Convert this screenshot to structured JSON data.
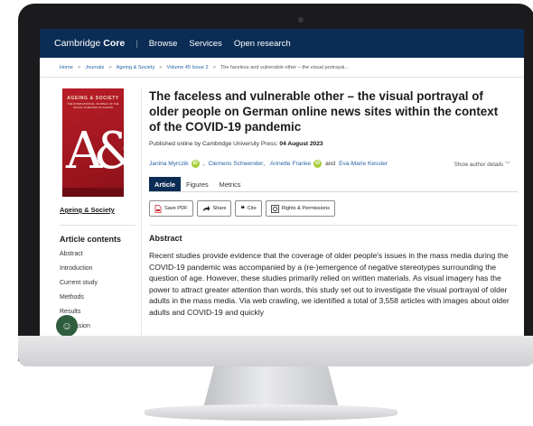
{
  "nav": {
    "logo_regular": "Cambridge",
    "logo_bold": "Core",
    "links": [
      "Browse",
      "Services",
      "Open research"
    ]
  },
  "breadcrumb": [
    "Home",
    "Journals",
    "Ageing & Society",
    "Volume 45 Issue 2",
    "The faceless and vulnerable other – the visual portrayal..."
  ],
  "journal": {
    "cover_title": "AGEING & SOCIETY",
    "cover_subtitle": "THE INTERNATIONAL JOURNAL OF THE SOCIAL SCIENCES OF AGEING",
    "cover_mark": "A&S",
    "link": "Ageing & Society"
  },
  "article_contents": {
    "heading": "Article contents",
    "items": [
      "Abstract",
      "Introduction",
      "Current study",
      "Methods",
      "Results",
      "Discussion"
    ]
  },
  "article": {
    "title": "The faceless and vulnerable other – the visual portrayal of older people on German online news sites within the context of the COVID-19 pandemic",
    "published_label": "Published online by Cambridge University Press:",
    "published_date": "04 August 2023",
    "authors": [
      "Janina Myrczik",
      "Clemens Schwender",
      "Annette Franke",
      "Eva-Marie Kessler"
    ],
    "and": "and",
    "show_details": "Show author details ﹀",
    "tabs": [
      "Article",
      "Figures",
      "Metrics"
    ],
    "actions": [
      {
        "icon": "pdf-icon",
        "label": "Save PDF"
      },
      {
        "icon": "share-icon",
        "label": "Share"
      },
      {
        "icon": "quote-icon",
        "label": "Cite"
      },
      {
        "icon": "rights-icon",
        "label": "Rights & Permissions"
      }
    ],
    "abstract_heading": "Abstract",
    "abstract_text": "Recent studies provide evidence that the coverage of older people's issues in the mass media during the COVID-19 pandemic was accompanied by a (re-)emergence of negative stereotypes surrounding the question of age. However, these studies primarily relied on written materials. As visual imagery has the power to attract greater attention than words, this study set out to investigate the visual portrayal of older adults in the mass media. Via web crawling, we identified a total of 3,558 articles with images about older adults and COVID-19 and quickly"
  },
  "colors": {
    "navy": "#0b2d55",
    "link_blue": "#2a63a6",
    "orcid_green": "#a6ce39",
    "cover_red": "#b91d28"
  }
}
